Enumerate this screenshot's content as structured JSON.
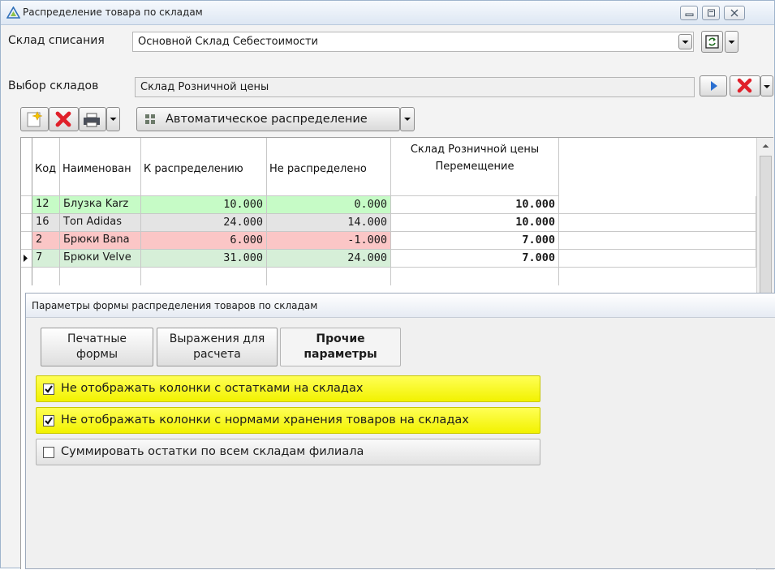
{
  "window": {
    "title": "Распределение товара по складам"
  },
  "form": {
    "sklad_spisaniya_label": "Склад списания",
    "sklad_spisaniya_value": "Основной Склад Себестоимости",
    "vybor_skladov_label": "Выбор складов",
    "vybor_skladov_value": "Склад Розничной цены"
  },
  "toolbar": {
    "auto_distribute_label": "Автоматическое распределение"
  },
  "grid": {
    "columns": {
      "kod": "Код",
      "name": "Наименован",
      "k_raspr": "К распределению",
      "ne_raspr": "Не распределено",
      "sklad_line1": "Склад Розничной цены",
      "sklad_line2": "Перемещение"
    },
    "rows": [
      {
        "kod": "12",
        "name": "Блузка Karz",
        "k_raspr": "10.000",
        "ne_raspr": "0.000",
        "move": "10.000",
        "bg": "#c6fbc6"
      },
      {
        "kod": "16",
        "name": "Топ Adidas",
        "k_raspr": "24.000",
        "ne_raspr": "14.000",
        "move": "10.000",
        "bg": "#e4e4e4"
      },
      {
        "kod": "2",
        "name": "Брюки Bana",
        "k_raspr": "6.000",
        "ne_raspr": "-1.000",
        "move": "7.000",
        "bg": "#fbc6c6"
      },
      {
        "kod": "7",
        "name": "Брюки Velve",
        "k_raspr": "31.000",
        "ne_raspr": "24.000",
        "move": "7.000",
        "bg": "#d6efd8"
      }
    ]
  },
  "dialog": {
    "title": "Параметры формы распределения товаров по складам",
    "tabs": [
      {
        "line1": "Печатные",
        "line2": "формы"
      },
      {
        "line1": "Выражения для",
        "line2": "расчета"
      },
      {
        "line1": "Прочие",
        "line2": "параметры"
      }
    ],
    "options": [
      {
        "label": "Не отображать колонки с остатками на складах",
        "checked": true
      },
      {
        "label": "Не отображать колонки с нормами хранения товаров на складах",
        "checked": true
      },
      {
        "label": "Суммировать остатки по всем складам филиала",
        "checked": false
      }
    ]
  },
  "colors": {
    "highlight": "#ffff33",
    "delete_red": "#e0202a",
    "nav_blue": "#2b6fd0"
  }
}
